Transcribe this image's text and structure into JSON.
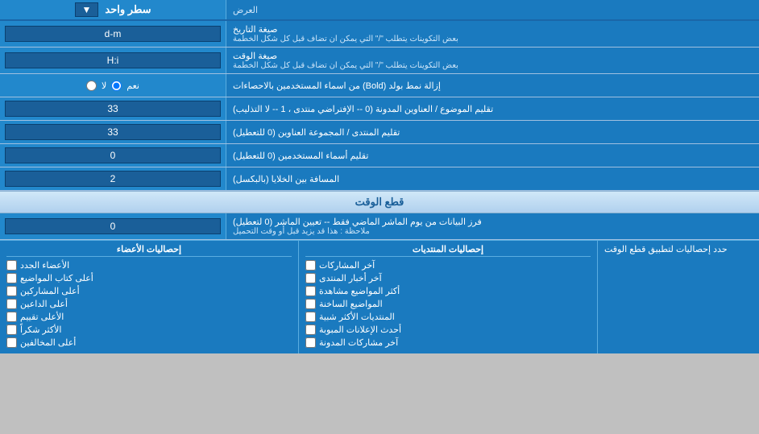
{
  "header": {
    "title": "سطر واحد",
    "dropdown_label": "▼"
  },
  "rows": [
    {
      "id": "date-format",
      "label": "صيغة التاريخ",
      "sub_label": "بعض التكوينات يتطلب \"/\" التي يمكن ان تضاف قبل كل شكل الخطمة",
      "input_value": "d-m",
      "type": "text"
    },
    {
      "id": "time-format",
      "label": "صيغة الوقت",
      "sub_label": "بعض التكوينات يتطلب \"/\" التي يمكن ان تضاف قبل كل شكل الخطمة",
      "input_value": "H:i",
      "type": "text"
    },
    {
      "id": "bold-remove",
      "label": "إزالة نمط بولد (Bold) من اسماء المستخدمين بالاحصاءات",
      "type": "radio",
      "options": [
        {
          "value": "نعم",
          "selected": true
        },
        {
          "value": "لا",
          "selected": false
        }
      ]
    },
    {
      "id": "topic-order",
      "label": "تقليم الموضوع / العناوين المدونة (0 -- الإفتراضي منتدى ، 1 -- لا التذليب)",
      "input_value": "33",
      "type": "text"
    },
    {
      "id": "forum-order",
      "label": "تقليم المنتدى / المجموعة العناوين (0 للتعطيل)",
      "input_value": "33",
      "type": "text"
    },
    {
      "id": "username-trim",
      "label": "تقليم أسماء المستخدمين (0 للتعطيل)",
      "input_value": "0",
      "type": "text"
    },
    {
      "id": "cell-distance",
      "label": "المسافة بين الخلايا (بالبكسل)",
      "input_value": "2",
      "type": "text"
    }
  ],
  "section_time": {
    "title": "قطع الوقت"
  },
  "time_row": {
    "label": "فرز البيانات من يوم الماشر الماضي فقط -- تعيين الماشر (0 لتعطيل)",
    "note": "ملاحظة : هذا قد يزيد قبل أو وقت التحميل",
    "input_value": "0"
  },
  "bottom": {
    "right_label": "حدد إحصاليات لتطبيق قطع الوقت",
    "middle_header": "إحصاليات المنتديات",
    "left_header": "إحصاليات الأعضاء",
    "middle_items": [
      "آخر المشاركات",
      "آخر أخبار المنتدى",
      "أكثر المواضيع مشاهدة",
      "المواضيع الساخنة",
      "المنتديات الأكثر شبية",
      "أحدث الإعلانات المبوبة",
      "آخر مشاركات المدونة"
    ],
    "left_items": [
      "الأعضاء الجدد",
      "أعلى كتاب المواضيع",
      "أعلى المشاركين",
      "أعلى الداعين",
      "الأعلى تقييم",
      "الأكثر شكراً",
      "أعلى المخالفين"
    ]
  }
}
